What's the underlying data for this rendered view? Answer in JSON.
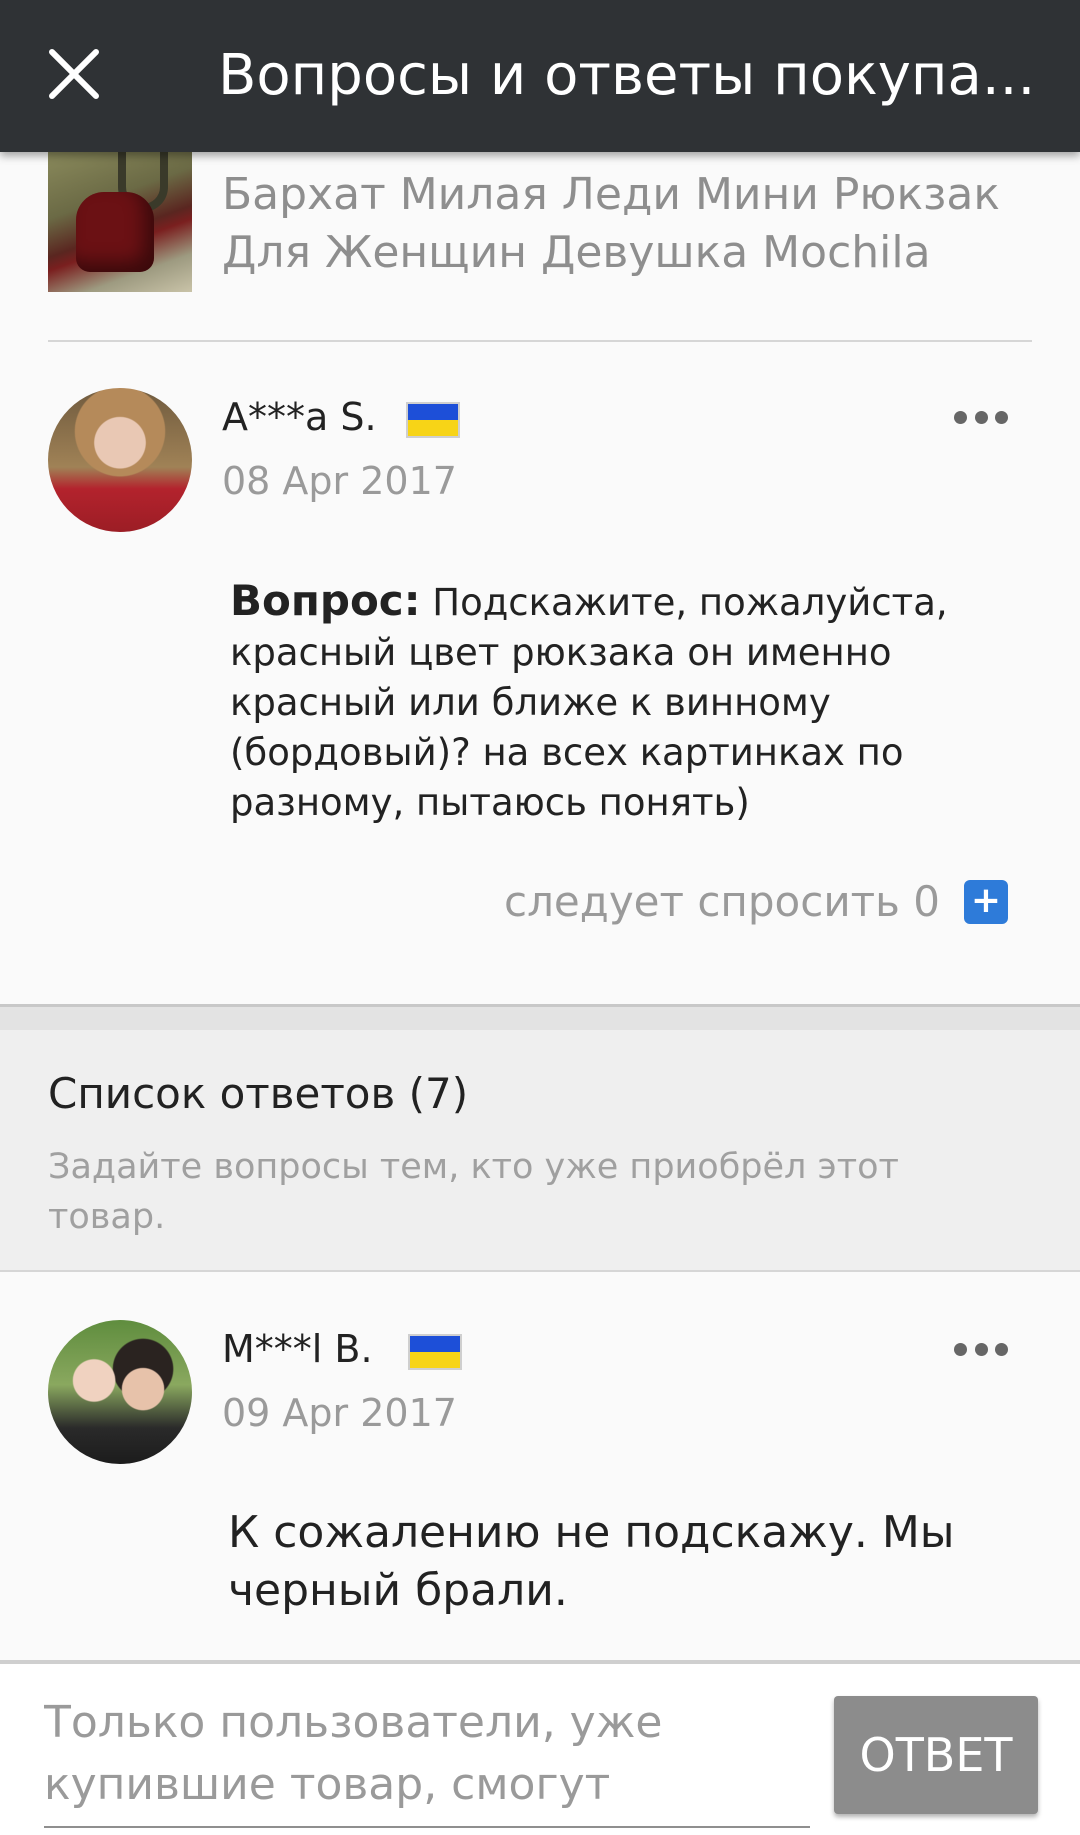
{
  "header": {
    "title": "Вопросы и ответы покупа..."
  },
  "product": {
    "name": "Бархат Милая Леди Мини Рюкзак Для Женщин Девушка Mochila"
  },
  "question": {
    "user_name": "A***a S.",
    "country_flag": "ukraine-flag",
    "date": "08 Apr 2017",
    "label": "Вопрос:",
    "text": " Подскажите, пожалуйста, красный цвет рюкзака он именно красный или ближе к винному (бордовый)? на всех картинках по разному, пытаюсь понять)",
    "follow_label": "следует спросить 0",
    "plus_symbol": "+"
  },
  "answers_section": {
    "title": "Список ответов (7)",
    "hint": "Задайте вопросы тем, кто уже приобрёл этот товар."
  },
  "answers": [
    {
      "user_name": "M***l B.",
      "country_flag": "ukraine-flag",
      "date": "09 Apr 2017",
      "text": "К сожалению не подскажу. Мы черный брали."
    }
  ],
  "bottom": {
    "input_placeholder": "Только пользователи, уже купившие товар, смогут",
    "reply_label": "ОТВЕТ"
  },
  "colors": {
    "header_bg": "#2f3235",
    "accent_blue": "#2e7bd9",
    "button_gray": "#8c8c8c"
  }
}
